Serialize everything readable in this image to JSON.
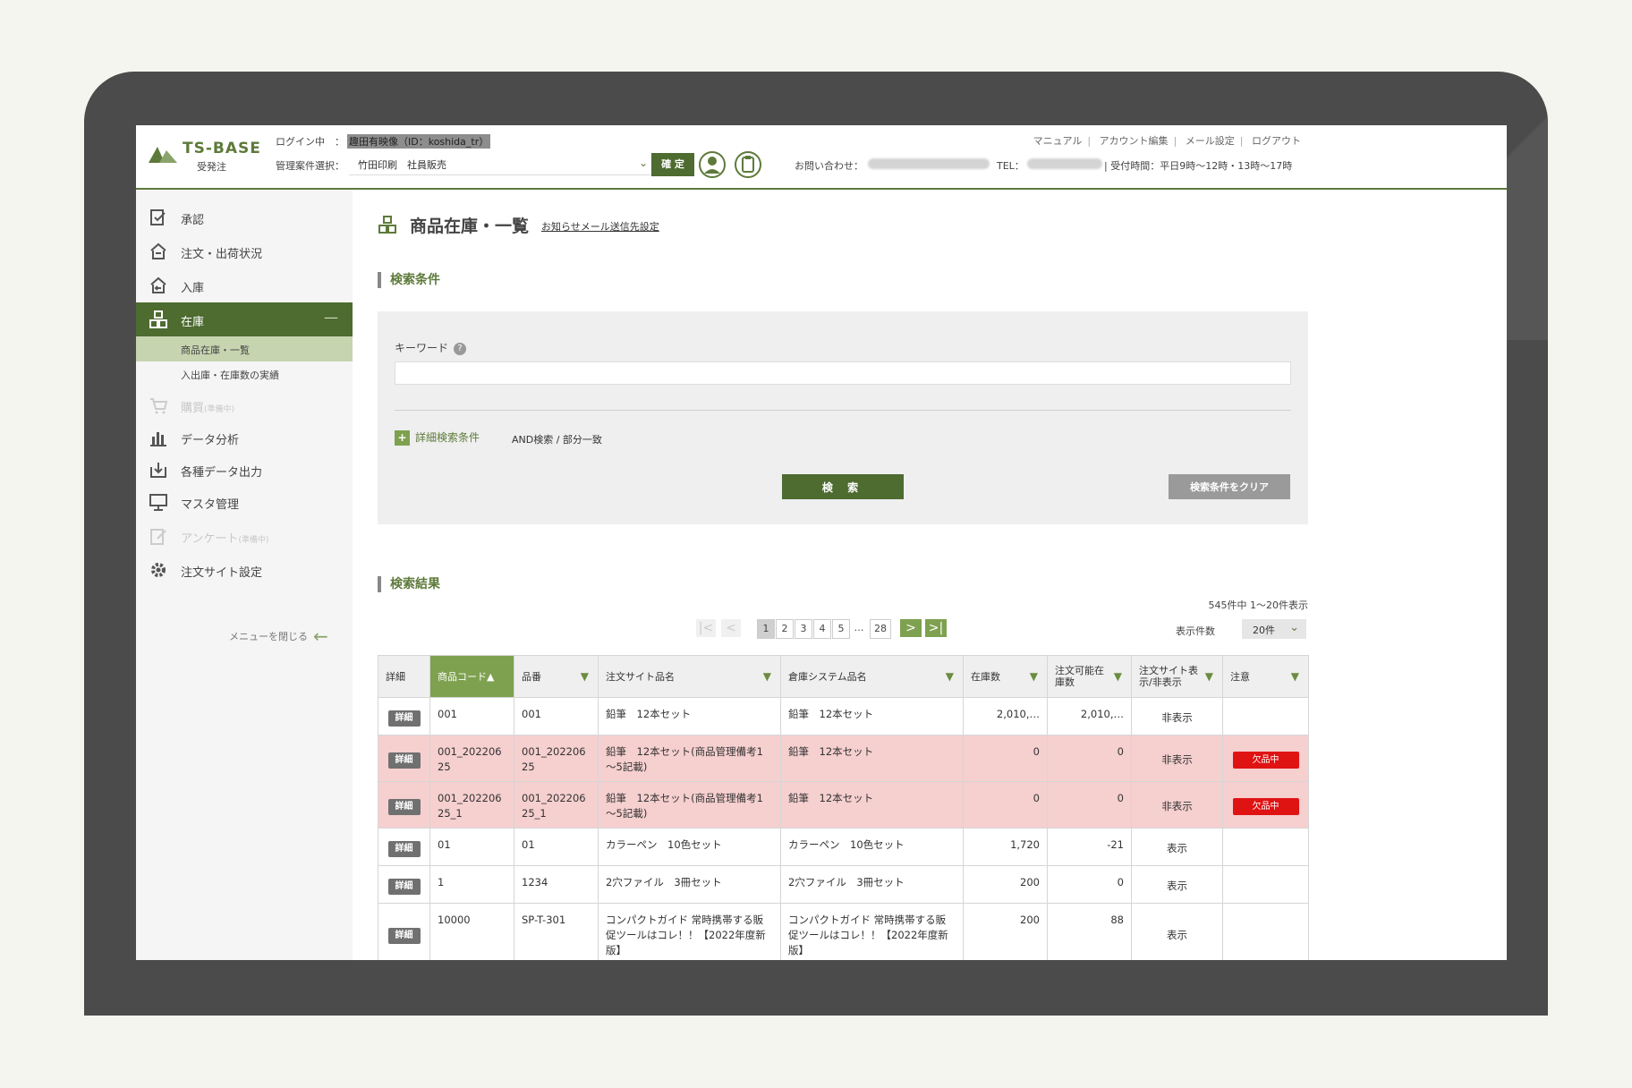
{
  "header": {
    "logo_name": "TS-BASE",
    "logo_sub": "受発注",
    "login_label": "ログイン中　：",
    "login_user": "趣田有映像（ID：koshida_tr）",
    "mgmt_label": "管理案件選択：",
    "case_value": "竹田印刷　社員販売",
    "confirm_label": "確 定",
    "contact_label": "お問い合わせ：",
    "tel_label": "TEL：",
    "hours": "| 受付時間：平日9時〜12時・13時〜17時",
    "links": [
      "マニュアル",
      "アカウント編集",
      "メール設定",
      "ログアウト"
    ]
  },
  "sidebar": {
    "items": [
      {
        "label": "承認",
        "icon": "approve-icon"
      },
      {
        "label": "注文・出荷状況",
        "icon": "order-icon"
      },
      {
        "label": "入庫",
        "icon": "inbound-icon"
      },
      {
        "label": "在庫",
        "icon": "stock-icon",
        "active": true
      },
      {
        "label": "購買",
        "tag": "(準備中)",
        "icon": "cart-icon",
        "disabled": true
      },
      {
        "label": "データ分析",
        "icon": "chart-icon"
      },
      {
        "label": "各種データ出力",
        "icon": "download-icon"
      },
      {
        "label": "マスタ管理",
        "icon": "monitor-icon"
      },
      {
        "label": "アンケート",
        "tag": "(準備中)",
        "icon": "survey-icon",
        "disabled": true
      },
      {
        "label": "注文サイト設定",
        "icon": "gear-icon"
      }
    ],
    "subitems": [
      "商品在庫・一覧",
      "入出庫・在庫数の実績"
    ],
    "close_menu": "メニューを閉じる"
  },
  "main": {
    "title": "商品在庫・一覧",
    "notify_link": "お知らせメール送信先設定",
    "search_section": "検索条件",
    "keyword_label": "キーワード",
    "keyword_value": "",
    "advanced_label": "詳細検索条件",
    "and_mode": "AND検索 / 部分一致",
    "search_button": "検 索",
    "clear_button": "検索条件をクリア",
    "result_section": "検索結果",
    "result_count": "545件中 1〜20件表示",
    "pager": [
      "1",
      "2",
      "3",
      "4",
      "5",
      "…",
      "28"
    ],
    "perpage_label": "表示件数",
    "perpage_value": "20件"
  },
  "table": {
    "headers": [
      "詳細",
      "商品コード▲",
      "品番",
      "注文サイト品名",
      "倉庫システム品名",
      "在庫数",
      "注文可能在庫数",
      "注文サイト表示/非表示",
      "注意"
    ],
    "detail_label": "詳細",
    "rows": [
      {
        "code": "001",
        "part": "001",
        "site_name": "鉛筆　12本セット",
        "wh_name": "鉛筆　12本セット",
        "stock": "2,010,…",
        "orderable": "2,010,…",
        "visibility": "非表示",
        "note": ""
      },
      {
        "code": "001_20220625",
        "part": "001_20220625",
        "site_name": "鉛筆　12本セット(商品管理備考1～5記載)",
        "wh_name": "鉛筆　12本セット",
        "stock": "0",
        "orderable": "0",
        "visibility": "非表示",
        "note": "欠品中"
      },
      {
        "code": "001_20220625_1",
        "part": "001_20220625_1",
        "site_name": "鉛筆　12本セット(商品管理備考1～5記載)",
        "wh_name": "鉛筆　12本セット",
        "stock": "0",
        "orderable": "0",
        "visibility": "非表示",
        "note": "欠品中"
      },
      {
        "code": "01",
        "part": "01",
        "site_name": "カラーペン　10色セット",
        "wh_name": "カラーペン　10色セット",
        "stock": "1,720",
        "orderable": "-21",
        "visibility": "表示",
        "note": ""
      },
      {
        "code": "1",
        "part": "1234",
        "site_name": "2穴ファイル　3冊セット",
        "wh_name": "2穴ファイル　3冊セット",
        "stock": "200",
        "orderable": "0",
        "visibility": "表示",
        "note": ""
      },
      {
        "code": "10000",
        "part": "SP-T-301",
        "site_name": "コンパクトガイド 常時携帯する販促ツールはコレ！！【2022年度新版】",
        "wh_name": "コンパクトガイド 常時携帯する販促ツールはコレ！！【2022年度新版】",
        "stock": "200",
        "orderable": "88",
        "visibility": "表示",
        "note": ""
      }
    ]
  },
  "colors": {
    "brand": "#5d7a3a",
    "brand_light": "#7ea14f",
    "warn_row": "#f6cfcf",
    "badge": "#e01313"
  }
}
